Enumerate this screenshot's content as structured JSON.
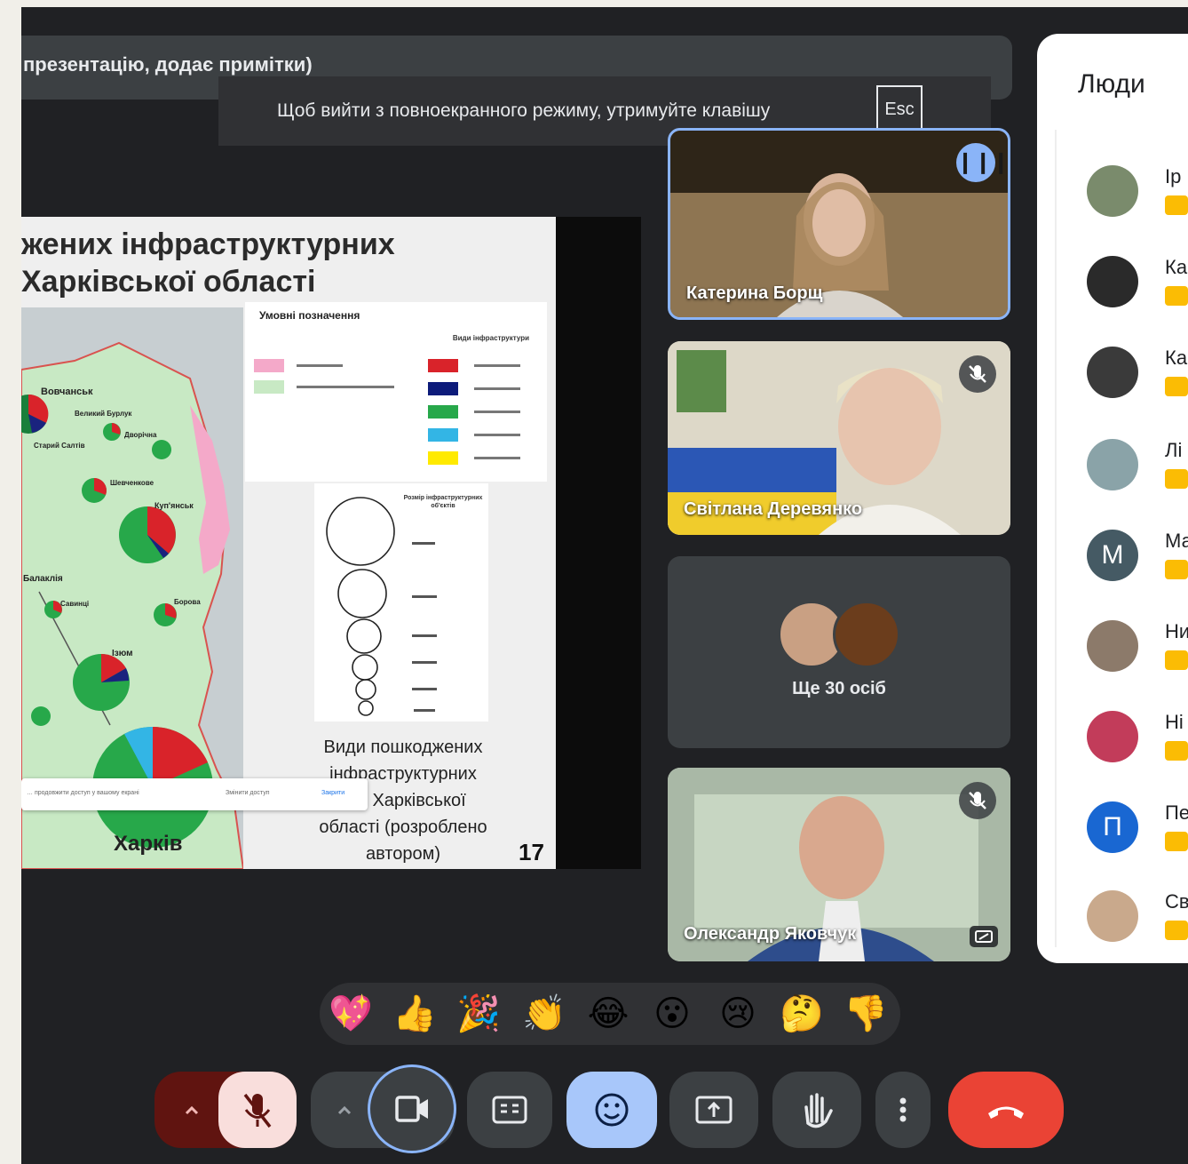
{
  "banner": {
    "presentation_text": "презентацію, додає примітки)"
  },
  "fullscreen": {
    "message": "Щоб вийти з повноекранного режиму, утримуйте клавішу",
    "key": "Esc"
  },
  "slide": {
    "title_line1": "жених інфраструктурних",
    "title_line2": "Харківської області",
    "legend_title": "Умовні позначення",
    "legend_subtitle": "Види інфраструктури",
    "circles_title": "Розмір інфраструктурних об'єктів",
    "caption_l1": "Види пошкоджених",
    "caption_l2": "інфраструктурних",
    "caption_l3": "…в Харківської",
    "caption_l4": "області  (розроблено",
    "caption_l5": "автором)",
    "page_number": "17",
    "city_label": "Харків",
    "map_labels": [
      "Вовчанськ",
      "Великий Бурлук",
      "Дворічна",
      "Старий Салтів",
      "Шевченкове",
      "Куп'янськ",
      "Балаклія",
      "Савинці",
      "Борова",
      "Ізюм"
    ],
    "popup": {
      "text": "… продовжити доступ у вашому екрані",
      "button1": "Змінити доступ",
      "button2": "Закрити"
    }
  },
  "tiles": [
    {
      "name": "Катерина Борщ",
      "speaking": true
    },
    {
      "name": "Світлана Деревянко",
      "muted": true
    },
    {
      "more_label": "Ще 30 осіб"
    },
    {
      "name": "Олександр Яковчук",
      "muted": true
    }
  ],
  "people_panel": {
    "title": "Люди",
    "participants": [
      {
        "name": "Ір",
        "avatar_color": "#7a8b6c"
      },
      {
        "name": "Ка",
        "avatar_color": "#2a2a2a"
      },
      {
        "name": "Ка",
        "avatar_color": "#3a3a3a"
      },
      {
        "name": "Лі",
        "avatar_color": "#8aa3a8"
      },
      {
        "name": "Ма",
        "initial": "М",
        "avatar_color": "#455a64"
      },
      {
        "name": "Ни",
        "avatar_color": "#8c7a6a"
      },
      {
        "name": "Ні",
        "avatar_color": "#c23c5a"
      },
      {
        "name": "Пе",
        "initial": "П",
        "avatar_color": "#1967d2"
      },
      {
        "name": "Св",
        "avatar_color": "#c9a98c"
      }
    ]
  },
  "reactions": [
    "💖",
    "👍",
    "🎉",
    "👏",
    "😂",
    "😮",
    "😢",
    "🤔",
    "👎"
  ],
  "controls": {
    "colors": {
      "mic_off_bg": "#f9dedc",
      "mic_group_bg": "#601410",
      "end_call": "#ea4335",
      "emoji_active": "#a8c7fa"
    }
  }
}
